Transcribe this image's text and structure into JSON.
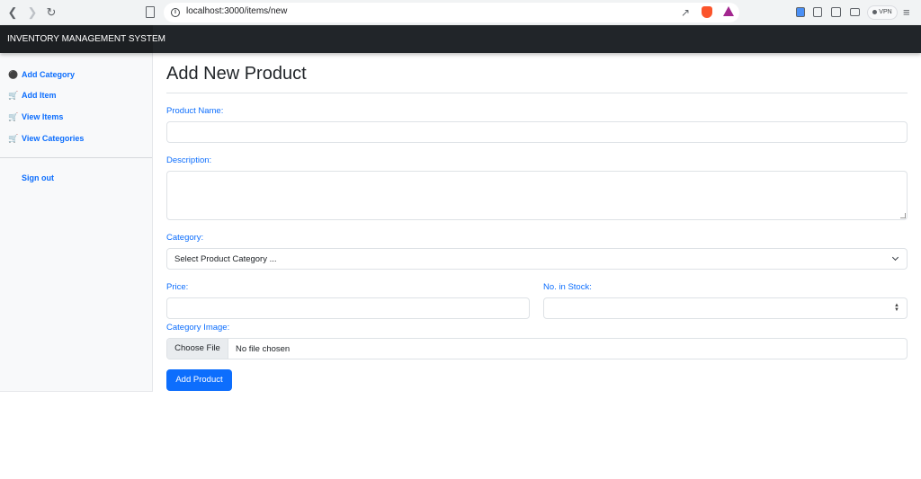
{
  "browser": {
    "url": "localhost:3000/items/new",
    "vpn_label": "VPN"
  },
  "navbar": {
    "brand": "INVENTORY MANAGEMENT SYSTEM",
    "brand_color": "#1c1f22",
    "bar_color": "#212529"
  },
  "sidebar": {
    "items": [
      {
        "label": "Add Category",
        "icon": "tag-icon"
      },
      {
        "label": "Add Item",
        "icon": "cart-icon"
      },
      {
        "label": "View Items",
        "icon": "cart-icon"
      },
      {
        "label": "View Categories",
        "icon": "cart-icon"
      }
    ],
    "sign_out": "Sign out"
  },
  "form": {
    "title": "Add New Product",
    "product_name": {
      "label": "Product Name:",
      "value": ""
    },
    "description": {
      "label": "Description:",
      "value": ""
    },
    "category": {
      "label": "Category:",
      "selected": "Select Product Category ..."
    },
    "price": {
      "label": "Price:",
      "value": ""
    },
    "stock": {
      "label": "No. in Stock:",
      "value": ""
    },
    "image": {
      "label": "Category Image:",
      "button": "Choose File",
      "status": "No file chosen"
    },
    "submit": "Add Product"
  },
  "colors": {
    "accent": "#0d6efd",
    "text": "#212529"
  }
}
